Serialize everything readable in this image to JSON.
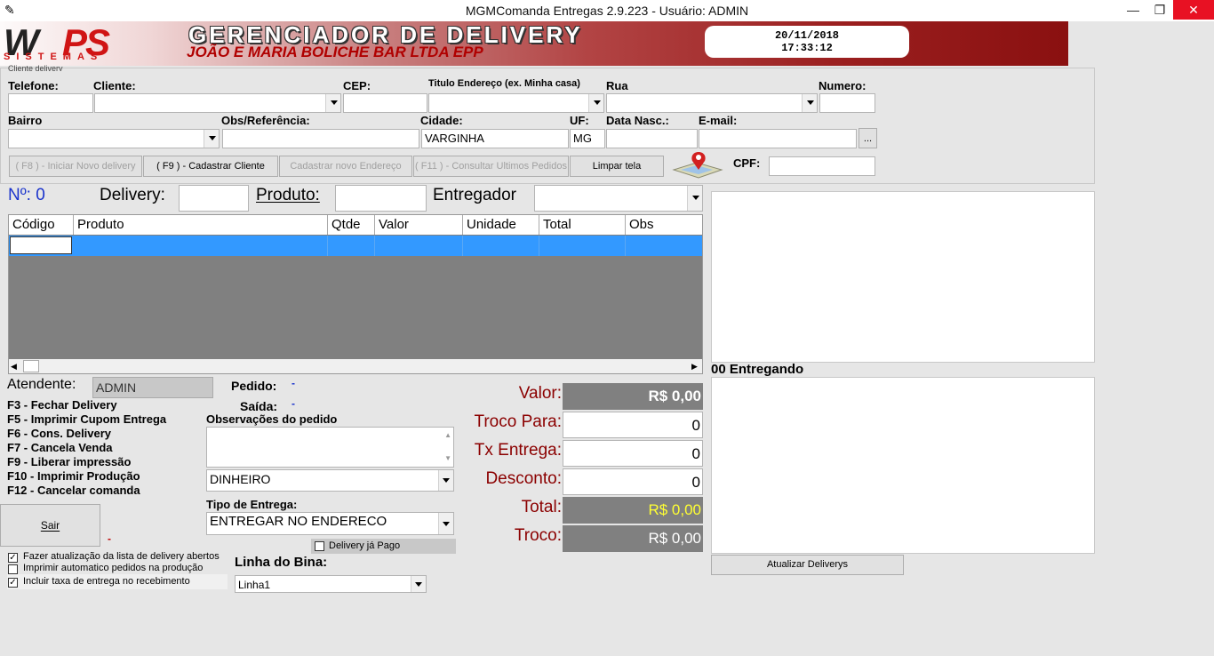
{
  "window": {
    "title": "MGMComanda Entregas 2.9.223 - Usuário: ADMIN"
  },
  "banner": {
    "logo_main": "WPS",
    "logo_w": "W",
    "logo_ps": "PS",
    "logo_sub": "SISTEMAS",
    "title": "GERENCIADOR DE DELIVERY",
    "company": "JOÃO E MARIA BOLICHE BAR LTDA EPP",
    "date": "20/11/2018",
    "time": "17:33:12"
  },
  "client": {
    "group_title": "Cliente delivery",
    "telefone_label": "Telefone:",
    "cliente_label": "Cliente:",
    "cep_label": "CEP:",
    "titulo_label": "Titulo Endereço (ex. Minha casa)",
    "rua_label": "Rua",
    "numero_label": "Numero:",
    "bairro_label": "Bairro",
    "obs_label": "Obs/Referência:",
    "cidade_label": "Cidade:",
    "cidade_value": "VARGINHA",
    "uf_label": "UF:",
    "uf_value": "MG",
    "nasc_label": "Data Nasc.:",
    "email_label": "E-mail:",
    "email_btn": "...",
    "cpf_label": "CPF:"
  },
  "actions": {
    "novo_delivery": "( F8 ) - Iniciar Novo delivery",
    "cadastrar_cliente": "( F9 ) - Cadastrar Cliente",
    "novo_endereco": "Cadastrar novo Endereço",
    "consultar": "( F11 ) - Consultar Ultimos Pedidos",
    "limpar": "Limpar tela"
  },
  "order": {
    "numero": "Nº: 0",
    "delivery_label": "Delivery:",
    "produto_label": "Produto:",
    "entregador_label": "Entregador",
    "columns": [
      "Código",
      "Produto",
      "Qtde",
      "Valor",
      "Unidade",
      "Total",
      "Obs"
    ]
  },
  "bottom": {
    "atendente_label": "Atendente:",
    "atendente_value": "ADMIN",
    "pedido_label": "Pedido:",
    "pedido_value": "-",
    "saida_label": "Saída:",
    "saida_value": "-",
    "obs_pedido_label": "Observações do pedido",
    "pagamento_value": "DINHEIRO",
    "tipo_entrega_label": "Tipo de Entrega:",
    "tipo_entrega_value": "ENTREGAR NO ENDERECO",
    "delivery_pago": "Delivery já Pago",
    "linha_bina_label": "Linha do Bina:",
    "linha_bina_value": "Linha1",
    "sair": "Sair",
    "sair_dash": "-",
    "shortcuts": [
      "F3 - Fechar Delivery",
      "F5 - Imprimir Cupom Entrega",
      "F6 - Cons. Delivery",
      "F7 - Cancela Venda",
      "F9 - Liberar impressão",
      "F10 - Imprimir Produção",
      "F12 - Cancelar comanda"
    ],
    "checkboxes": [
      {
        "label": "Fazer atualização da lista de delivery abertos",
        "checked": true
      },
      {
        "label": "Imprimir automatico pedidos na produção",
        "checked": false
      },
      {
        "label": "Incluir taxa de entrega no recebimento",
        "checked": true
      }
    ]
  },
  "totals": {
    "valor_label": "Valor:",
    "valor": "R$ 0,00",
    "troco_para_label": "Troco Para:",
    "troco_para": "0",
    "tx_entrega_label": "Tx Entrega:",
    "tx_entrega": "0",
    "desconto_label": "Desconto:",
    "desconto": "0",
    "total_label": "Total:",
    "total": "R$ 0,00",
    "troco_label": "Troco:",
    "troco": "R$ 0,00",
    "total_color": "#ffff33"
  },
  "right": {
    "entregando_label": "00 Entregando",
    "atualizar_btn": "Atualizar Deliverys"
  }
}
